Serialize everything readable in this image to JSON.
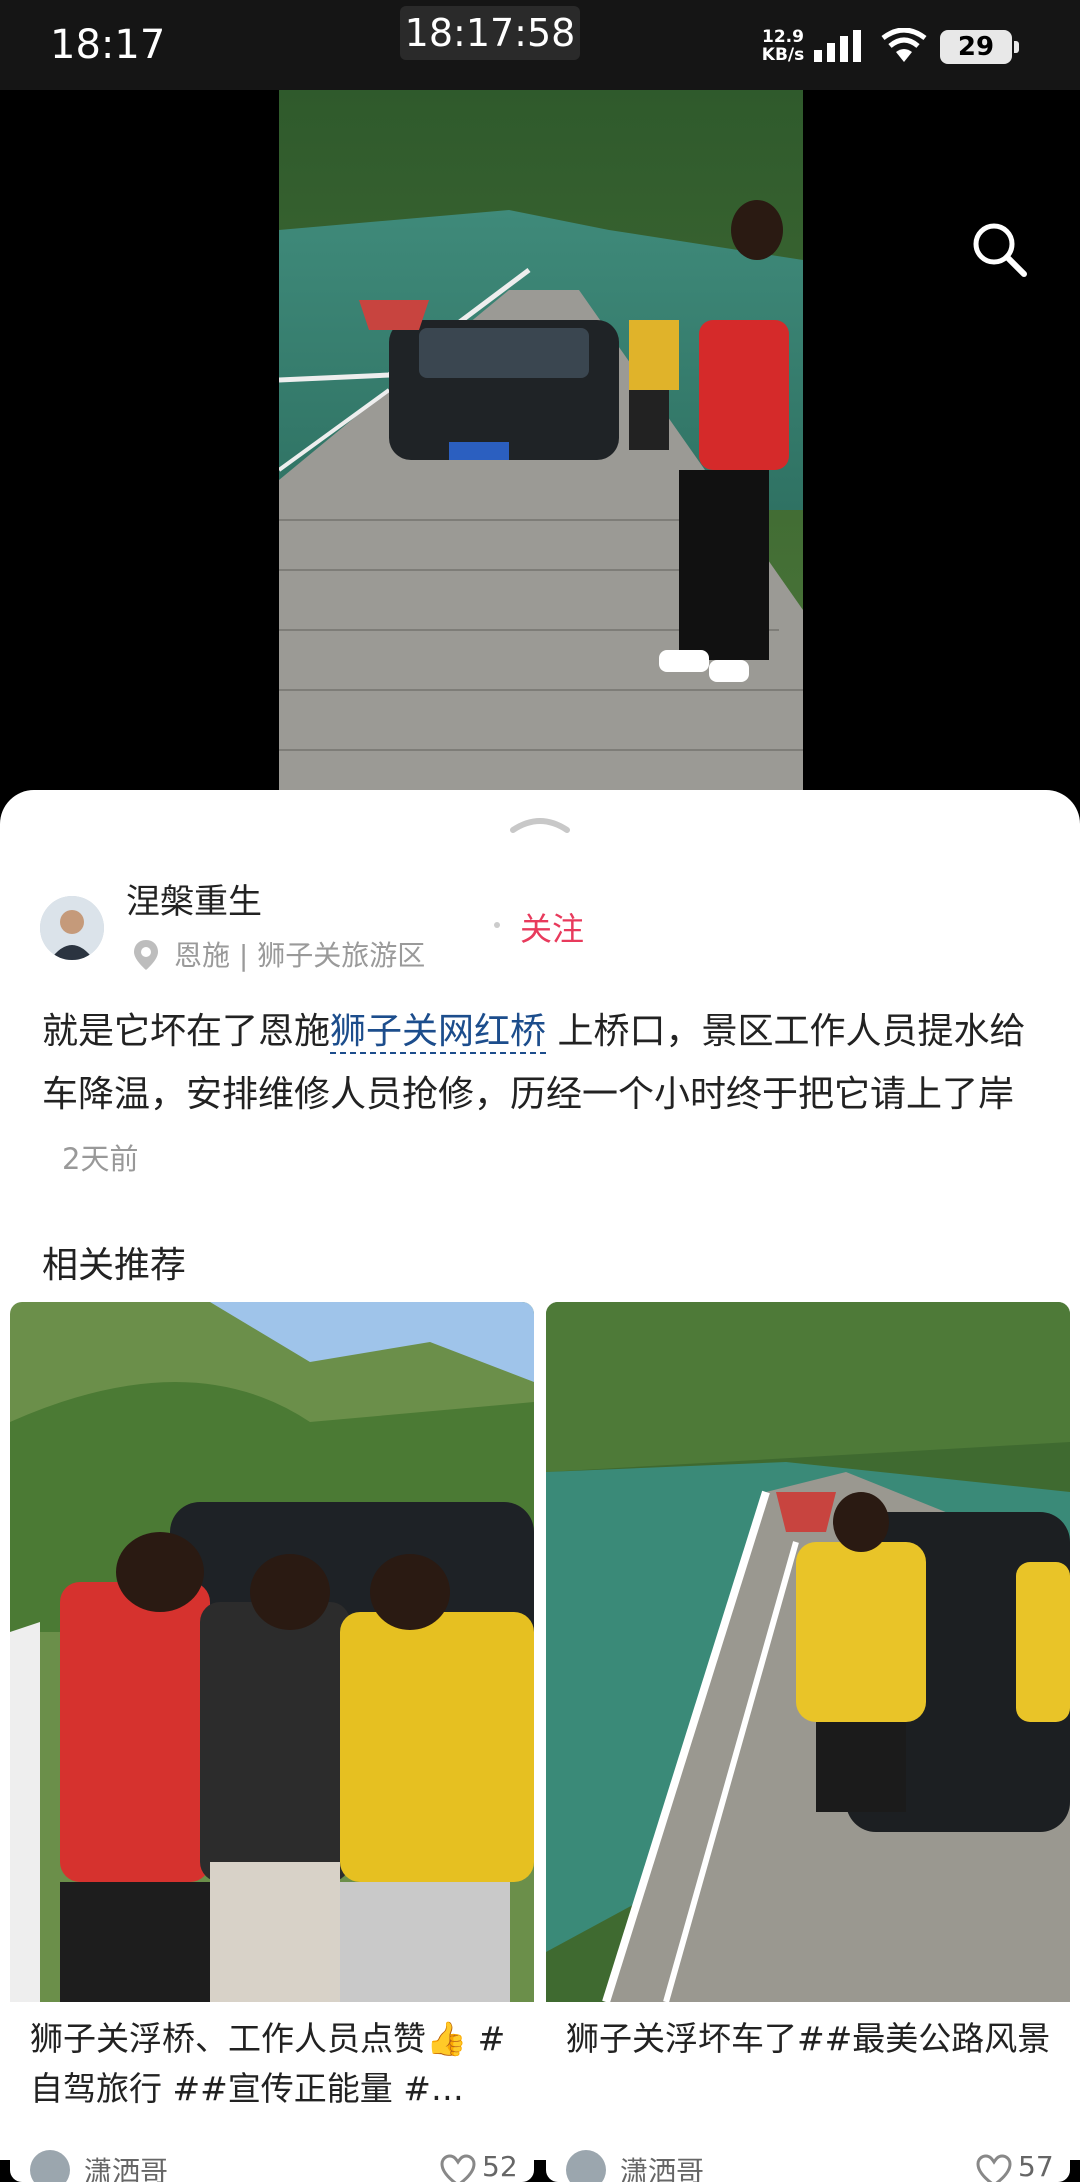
{
  "status_bar": {
    "time": "18:17",
    "center_time": "18:17:58",
    "net_speed_value": "12.9",
    "net_speed_unit": "KB/s",
    "battery": "29"
  },
  "post": {
    "author": "涅槃重生",
    "location": "恩施 | 狮子关旅游区",
    "follow_label": "关注",
    "text_before": "就是它坏在了恩施",
    "link_text": "狮子关网红桥",
    "text_after": " 上桥口，景区工作人员提水给车降温，安排维修人员抢修，历经一个小时终于把它请上了岸",
    "time_ago": "2天前"
  },
  "related": {
    "title": "相关推荐",
    "cards": [
      {
        "title": "狮子关浮桥、工作人员点赞👍 #自驾旅行 ##宣传正能量 #…",
        "author": "潇洒哥",
        "likes": "52"
      },
      {
        "title": "狮子关浮坏车了##最美公路风景",
        "author": "潇洒哥",
        "likes": "57"
      }
    ]
  },
  "icons": {
    "search": "search-icon",
    "location": "location-pin-icon",
    "handle": "chevron-up-icon",
    "like": "heart-icon"
  },
  "colors": {
    "follow": "#e83a5c",
    "link": "#1c4d8c",
    "status_bar_bg": "#151515"
  }
}
